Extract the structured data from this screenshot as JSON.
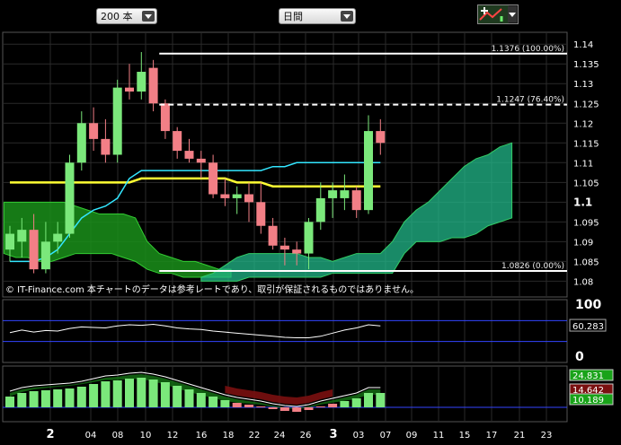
{
  "toolbar": {
    "count_select": "200 本",
    "period_select": "日間",
    "tool_icon": "cross-chart-icon"
  },
  "copyright": "© IT-Finance.com 本チャートのデータは参考レートであり、取引が保証されるものではありません。",
  "colors": {
    "up": "#7be87b",
    "down": "#f27f86",
    "kijun": "#ffff33",
    "tenkan": "#33e6ff",
    "kumo_bull": "#22b88a",
    "kumo_bear": "#1a8f1a"
  },
  "chart_data": [
    {
      "type": "candlestick",
      "name": "price",
      "ylim": [
        1.076,
        1.143
      ],
      "yticks": [
        "1.14",
        "1.135",
        "1.13",
        "1.125",
        "1.12",
        "1.115",
        "1.11",
        "1.105",
        "1.1",
        "1.095",
        "1.09",
        "1.085",
        "1.08"
      ],
      "xticks": [
        "2",
        "04",
        "08",
        "10",
        "12",
        "16",
        "18",
        "22",
        "24",
        "26",
        "3",
        "03",
        "07",
        "09",
        "11",
        "15",
        "17",
        "21",
        "23"
      ],
      "fib_levels": [
        {
          "label": "1.1376 (100.00%)",
          "value": 1.1376,
          "style": "solid"
        },
        {
          "label": "1.1247 (76.40%)",
          "value": 1.1247,
          "style": "dashed"
        },
        {
          "label": "1.0826 (0.00%)",
          "value": 1.0826,
          "style": "solid"
        }
      ],
      "candles": [
        {
          "o": 1.088,
          "h": 1.094,
          "l": 1.085,
          "c": 1.092
        },
        {
          "o": 1.09,
          "h": 1.096,
          "l": 1.086,
          "c": 1.093
        },
        {
          "o": 1.093,
          "h": 1.097,
          "l": 1.082,
          "c": 1.083
        },
        {
          "o": 1.083,
          "h": 1.095,
          "l": 1.082,
          "c": 1.09
        },
        {
          "o": 1.09,
          "h": 1.095,
          "l": 1.087,
          "c": 1.092
        },
        {
          "o": 1.092,
          "h": 1.112,
          "l": 1.091,
          "c": 1.11
        },
        {
          "o": 1.11,
          "h": 1.123,
          "l": 1.108,
          "c": 1.12
        },
        {
          "o": 1.12,
          "h": 1.124,
          "l": 1.113,
          "c": 1.116
        },
        {
          "o": 1.116,
          "h": 1.121,
          "l": 1.11,
          "c": 1.112
        },
        {
          "o": 1.112,
          "h": 1.131,
          "l": 1.11,
          "c": 1.129
        },
        {
          "o": 1.129,
          "h": 1.135,
          "l": 1.126,
          "c": 1.128
        },
        {
          "o": 1.128,
          "h": 1.138,
          "l": 1.126,
          "c": 1.133
        },
        {
          "o": 1.134,
          "h": 1.136,
          "l": 1.123,
          "c": 1.125
        },
        {
          "o": 1.125,
          "h": 1.126,
          "l": 1.116,
          "c": 1.118
        },
        {
          "o": 1.118,
          "h": 1.119,
          "l": 1.111,
          "c": 1.113
        },
        {
          "o": 1.113,
          "h": 1.116,
          "l": 1.11,
          "c": 1.111
        },
        {
          "o": 1.111,
          "h": 1.113,
          "l": 1.106,
          "c": 1.11
        },
        {
          "o": 1.11,
          "h": 1.112,
          "l": 1.101,
          "c": 1.102
        },
        {
          "o": 1.102,
          "h": 1.106,
          "l": 1.099,
          "c": 1.101
        },
        {
          "o": 1.101,
          "h": 1.104,
          "l": 1.097,
          "c": 1.102
        },
        {
          "o": 1.102,
          "h": 1.105,
          "l": 1.095,
          "c": 1.1
        },
        {
          "o": 1.1,
          "h": 1.105,
          "l": 1.092,
          "c": 1.094
        },
        {
          "o": 1.094,
          "h": 1.096,
          "l": 1.088,
          "c": 1.089
        },
        {
          "o": 1.089,
          "h": 1.091,
          "l": 1.084,
          "c": 1.088
        },
        {
          "o": 1.088,
          "h": 1.09,
          "l": 1.084,
          "c": 1.087
        },
        {
          "o": 1.087,
          "h": 1.096,
          "l": 1.083,
          "c": 1.095
        },
        {
          "o": 1.095,
          "h": 1.105,
          "l": 1.093,
          "c": 1.101
        },
        {
          "o": 1.101,
          "h": 1.105,
          "l": 1.096,
          "c": 1.103
        },
        {
          "o": 1.101,
          "h": 1.107,
          "l": 1.098,
          "c": 1.103
        },
        {
          "o": 1.103,
          "h": 1.104,
          "l": 1.096,
          "c": 1.098
        },
        {
          "o": 1.098,
          "h": 1.122,
          "l": 1.097,
          "c": 1.118
        },
        {
          "o": 1.118,
          "h": 1.121,
          "l": 1.112,
          "c": 1.115
        }
      ]
    },
    {
      "type": "line",
      "name": "rsi",
      "ylim": [
        0,
        100
      ],
      "yticks": [
        "100",
        "0"
      ],
      "last_label": "60.283",
      "levels": [
        70,
        30
      ],
      "values": [
        47,
        52,
        48,
        51,
        50,
        55,
        58,
        57,
        56,
        60,
        62,
        61,
        63,
        60,
        56,
        54,
        53,
        50,
        48,
        46,
        44,
        42,
        40,
        38,
        37,
        37,
        40,
        46,
        52,
        56,
        62,
        60
      ]
    },
    {
      "type": "bar",
      "name": "macd",
      "ylim": [
        -22,
        40
      ],
      "labels": [
        "24.831",
        "14.642",
        "10.189"
      ],
      "values": [
        6,
        10,
        12,
        13,
        14,
        15,
        17,
        20,
        23,
        24,
        26,
        27,
        25,
        22,
        18,
        14,
        10,
        6,
        2,
        -1,
        -3,
        -5,
        -8,
        -10,
        -11,
        -9,
        -5,
        -2,
        1,
        4,
        10,
        10
      ]
    }
  ]
}
